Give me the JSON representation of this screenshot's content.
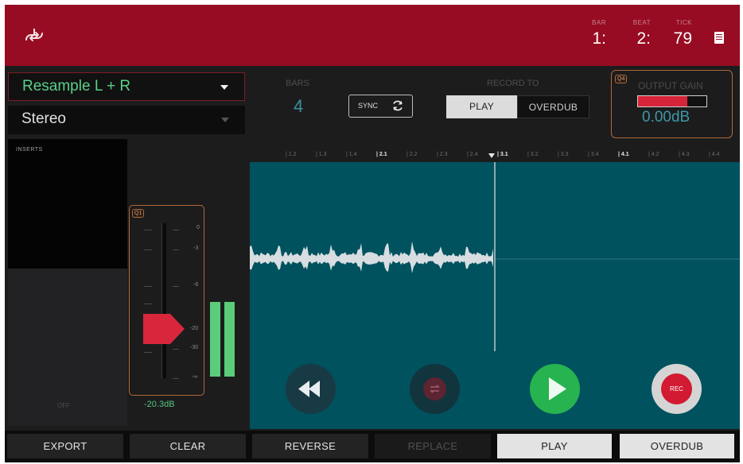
{
  "header": {
    "icon": "resample-icon",
    "position": {
      "bars_caption": "BAR",
      "beats_caption": "BEAT",
      "ticks_caption": "TICK",
      "bars": "1:",
      "beats": "2:",
      "ticks": "79"
    },
    "menu_icon": "menu-icon",
    "color": "#970c22"
  },
  "source": {
    "value": "Resample L + R"
  },
  "mode": {
    "value": "Stereo"
  },
  "inserts": {
    "label": "INSERTS",
    "status": "OFF"
  },
  "fader": {
    "badge": "Q1",
    "scale": [
      "0",
      "-3",
      "-6",
      "-20",
      "-30",
      "-∞"
    ],
    "level_db": -20.3,
    "value_label": "-20.3dB"
  },
  "bars": {
    "caption": "BARS",
    "value": "4"
  },
  "sync": {
    "label": "SYNC",
    "icon": "refresh-icon"
  },
  "record_to": {
    "caption": "RECORD TO",
    "options": [
      "PLAY",
      "OVERDUB"
    ],
    "selected": "PLAY"
  },
  "output_gain": {
    "badge": "Q4",
    "caption": "OUTPUT GAIN",
    "value": "0.00dB",
    "level_fraction": 0.72
  },
  "ruler": {
    "ticks": [
      "1.2",
      "1.3",
      "1.4",
      "2.1",
      "2.2",
      "2.3",
      "2.4",
      "3.1",
      "3.2",
      "3.3",
      "3.4",
      "4.1",
      "4.2",
      "4.3",
      "4.4"
    ]
  },
  "transport": {
    "rewind_icon": "rewind-icon",
    "loop_icon": "loop-icon",
    "play_icon": "play-icon",
    "rec_label": "REC"
  },
  "bottom_bar": {
    "export": "EXPORT",
    "clear": "CLEAR",
    "reverse": "REVERSE",
    "replace": "REPLACE",
    "play": "PLAY",
    "overdub": "OVERDUB"
  },
  "colors": {
    "accent_green": "#55c37e",
    "waveform_bg": "#00525e",
    "rec_red": "#d21a32",
    "play_green": "#27b34f"
  }
}
